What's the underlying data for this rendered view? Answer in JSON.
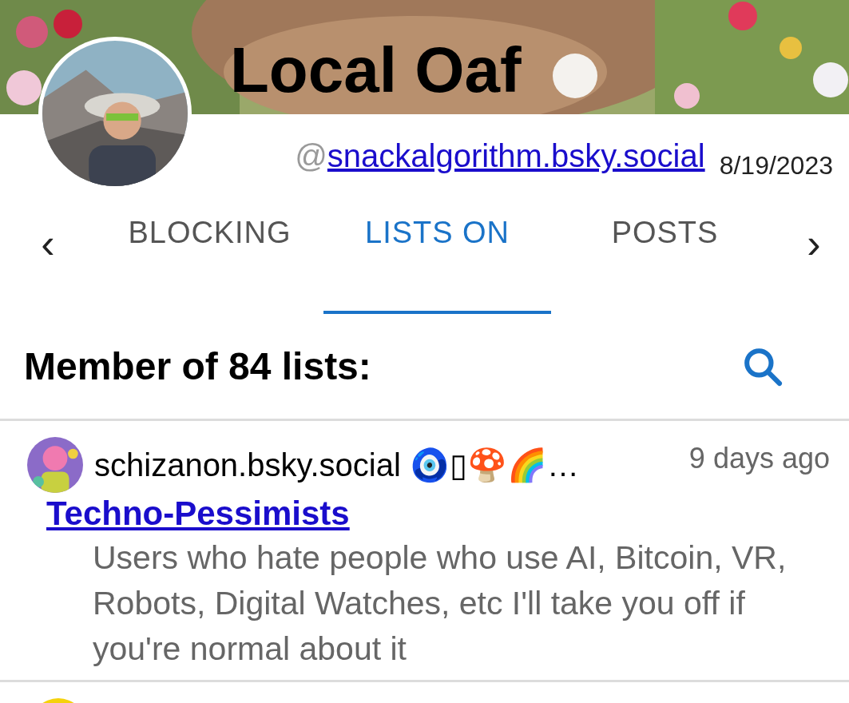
{
  "profile": {
    "name": "Local Oaf",
    "handle_prefix": "@",
    "handle": "snackalgorithm.bsky.social",
    "date": "8/19/2023"
  },
  "tabs_nav": {
    "prev": "‹",
    "next": "›"
  },
  "tabs": [
    {
      "label": "BLOCKING",
      "selected": false
    },
    {
      "label": "LISTS ON",
      "selected": true
    },
    {
      "label": "POSTS",
      "selected": false
    }
  ],
  "section": {
    "title": "Member of 84 lists:"
  },
  "lists": [
    {
      "owner": "schizanon.bsky.social 🧿▯🍄🌈…",
      "time": "9 days ago",
      "name": "Techno-Pessimists",
      "description": "Users who hate people who use AI, Bitcoin, VR, Robots, Digital Watches, etc I'll take you off if you're normal about it"
    }
  ]
}
